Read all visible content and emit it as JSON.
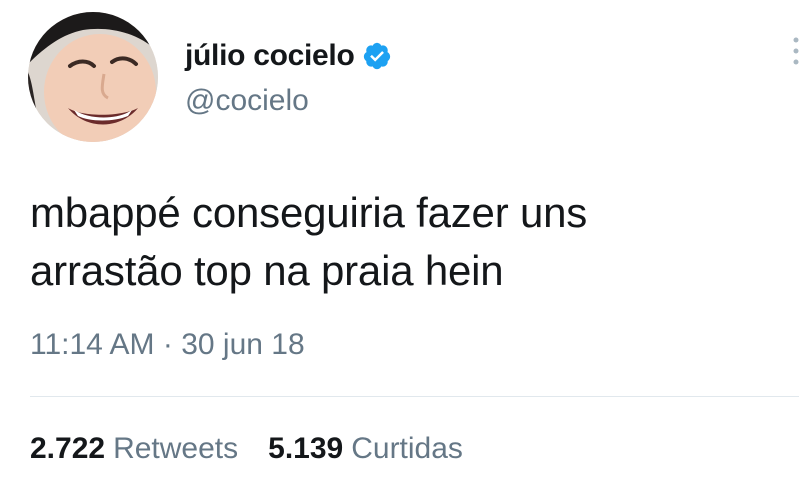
{
  "user": {
    "display_name": "júlio cocielo",
    "handle": "@cocielo",
    "avatar_icon": "profile-photo",
    "verified_icon": "verified-badge-icon"
  },
  "tweet": {
    "text_lines": [
      "mbappé conseguiria fazer uns",
      "arrastão top na praia hein"
    ],
    "time": "11:14 AM",
    "separator": "·",
    "date": "30 jun 18"
  },
  "stats": {
    "retweets_count": "2.722",
    "retweets_label": "Retweets",
    "likes_count": "5.139",
    "likes_label": "Curtidas"
  },
  "colors": {
    "text_primary": "#14171a",
    "text_secondary": "#657786",
    "verified_blue": "#1da1f2",
    "divider": "#e1e8ed"
  }
}
